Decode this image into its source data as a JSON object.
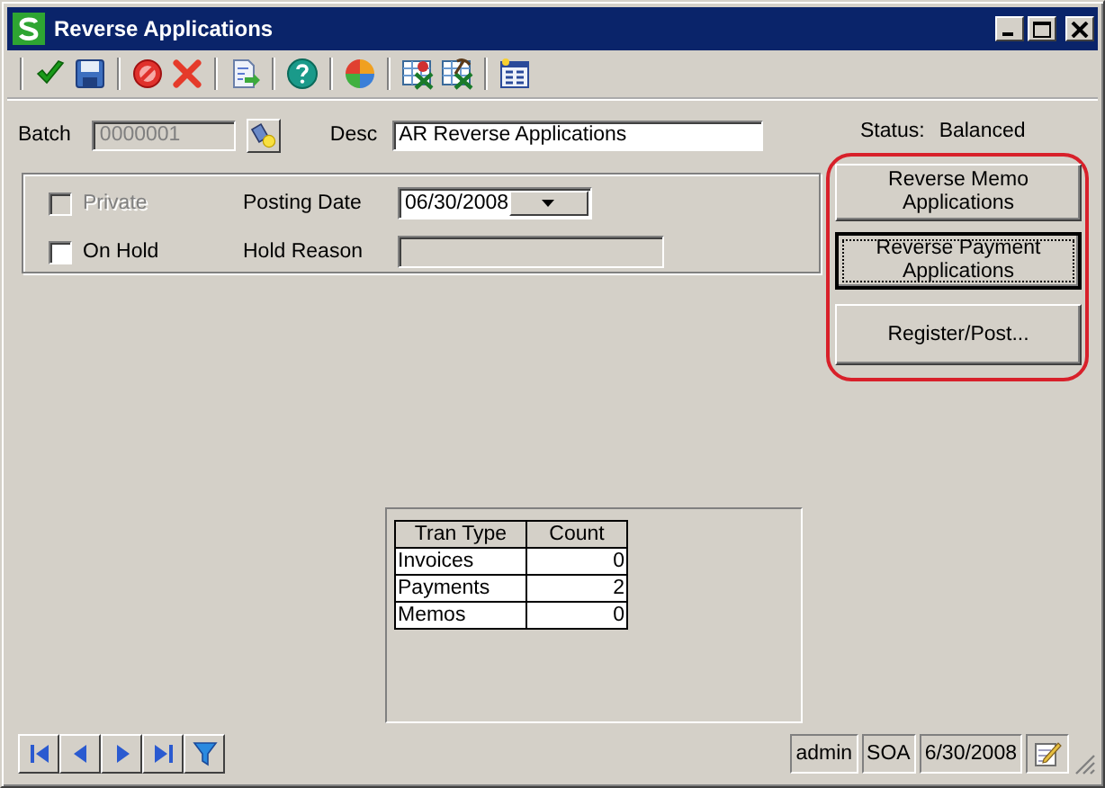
{
  "window": {
    "title": "Reverse Applications"
  },
  "batch": {
    "label": "Batch",
    "value": "0000001",
    "disabled": true
  },
  "desc": {
    "label": "Desc",
    "value": "AR Reverse Applications"
  },
  "status": {
    "label": "Status:",
    "value": "Balanced"
  },
  "options": [
    {
      "label": "Private",
      "checked": false,
      "disabled": true
    },
    {
      "label": "On Hold",
      "checked": false,
      "disabled": false
    }
  ],
  "posting_date": {
    "label": "Posting Date",
    "value": "06/30/2008"
  },
  "hold_reason": {
    "label": "Hold Reason",
    "disabled": true
  },
  "actions": [
    {
      "label": "Reverse Memo Applications",
      "focused": false
    },
    {
      "label": "Reverse Payment Applications",
      "focused": true
    },
    {
      "label": "Register/Post...",
      "focused": false
    }
  ],
  "counts": {
    "columns": [
      "Tran Type",
      "Count"
    ],
    "rows": [
      [
        "Invoices",
        "0"
      ],
      [
        "Payments",
        "2"
      ],
      [
        "Memos",
        "0"
      ]
    ]
  },
  "status_bar": [
    "admin",
    "SOA",
    "6/30/2008"
  ]
}
